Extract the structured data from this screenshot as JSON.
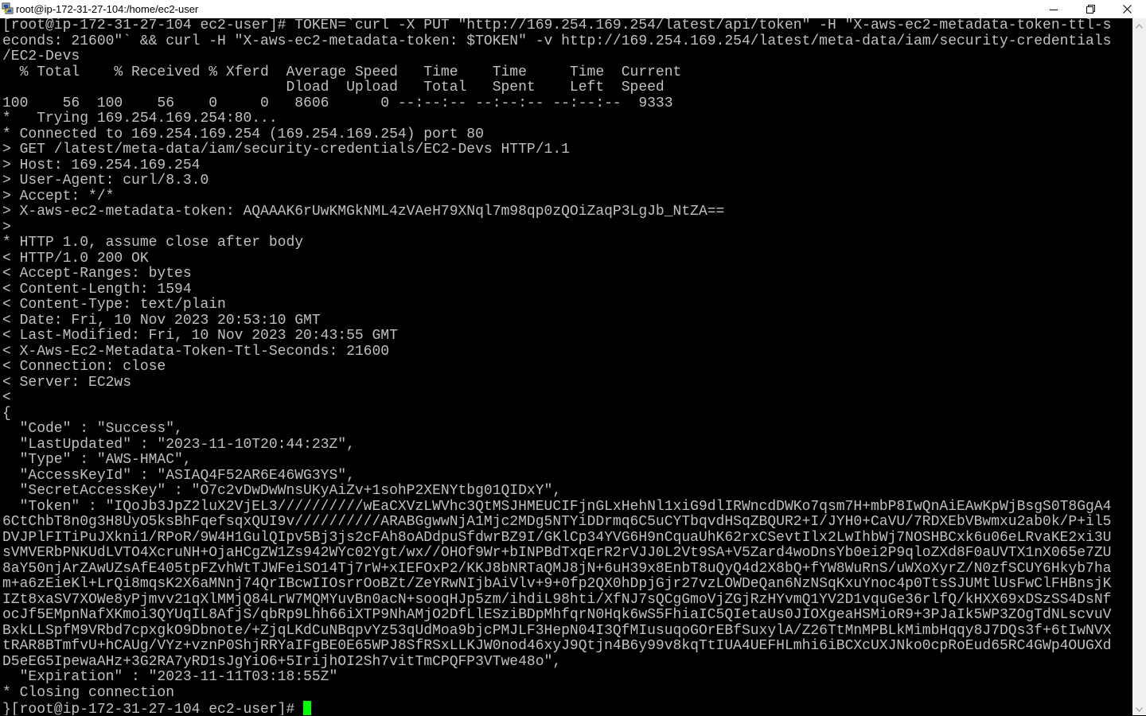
{
  "window": {
    "title": "root@ip-172-31-27-104:/home/ec2-user",
    "icons": {
      "app": "putty-icon",
      "minimize": "minimize-icon",
      "maximize": "restore-icon",
      "close": "close-icon"
    }
  },
  "terminal": {
    "colors": {
      "background": "#000000",
      "foreground": "#c0c0c0",
      "cursor": "#00ff00"
    },
    "lines": [
      "[root@ip-172-31-27-104 ec2-user]# TOKEN=`curl -X PUT \"http://169.254.169.254/latest/api/token\" -H \"X-aws-ec2-metadata-token-ttl-s",
      "econds: 21600\"` && curl -H \"X-aws-ec2-metadata-token: $TOKEN\" -v http://169.254.169.254/latest/meta-data/iam/security-credentials",
      "/EC2-Devs",
      "  % Total    % Received % Xferd  Average Speed   Time    Time     Time  Current",
      "                                 Dload  Upload   Total   Spent    Left  Speed",
      "100    56  100    56    0     0   8606      0 --:--:-- --:--:-- --:--:--  9333",
      "*   Trying 169.254.169.254:80...",
      "* Connected to 169.254.169.254 (169.254.169.254) port 80",
      "> GET /latest/meta-data/iam/security-credentials/EC2-Devs HTTP/1.1",
      "> Host: 169.254.169.254",
      "> User-Agent: curl/8.3.0",
      "> Accept: */*",
      "> X-aws-ec2-metadata-token: AQAAAK6rUwKMGkNML4zVAeH79XNql7m98qp0zQOiZaqP3LgJb_NtZA==",
      ">",
      "* HTTP 1.0, assume close after body",
      "< HTTP/1.0 200 OK",
      "< Accept-Ranges: bytes",
      "< Content-Length: 1594",
      "< Content-Type: text/plain",
      "< Date: Fri, 10 Nov 2023 20:53:10 GMT",
      "< Last-Modified: Fri, 10 Nov 2023 20:43:55 GMT",
      "< X-Aws-Ec2-Metadata-Token-Ttl-Seconds: 21600",
      "< Connection: close",
      "< Server: EC2ws",
      "<",
      "{",
      "  \"Code\" : \"Success\",",
      "  \"LastUpdated\" : \"2023-11-10T20:44:23Z\",",
      "  \"Type\" : \"AWS-HMAC\",",
      "  \"AccessKeyId\" : \"ASIAQ4F52AR6E46WG3YS\",",
      "  \"SecretAccessKey\" : \"O7c2vDwDwWnsUKyAiZv+1sohP2XENYtbg01QIDxY\",",
      "  \"Token\" : \"IQoJb3JpZ2luX2VjEL3//////////wEaCXVzLWVhc3QtMSJHMEUCIFjnGLxHehNl1xiG9dlIRWncdDWKo7qsm7H+mbP8IwQnAiEAwKpWjBsgS0T8GgA4",
      "6CtChbT8n0g3H8UyO5ksBhFqefsqxQUI9v//////////ARABGgwwNjA1Mjc2MDg5NTYiDDrmq6C5uCYTbqvdHSqZBQUR2+I/JYH0+CaVU/7RDXEbVBwmxu2ab0k/P+il5",
      "DVJPlFITiPuJXkni1/RPoR/9W4H1GulQIpv5Bj3js2cFAh8oADdpuSfdwrBZ9I/GKlCp34YVG6H9nCquaUhK62rxCSevtIlx2LwIhbWj7NOSHBCxk6u06eLRvaKE2xi3U",
      "sVMVERbPNKUdLVTO4XcruNH+OjaHCgZW1Zs942WYc02Ygt/wx//OHOf9Wr+bINPBdTxqErR2rVJJ0L2Vt9SA+V5Zard4woDnsYb0ei2P9qloZXd8F0aUVTX1nX065e7ZU",
      "8aY50njArZAwUZsAfE405tpFZvhWtTJWFeiSO14Tj7rW+xIEFOxP2/KKJ8bNRTaQMJ8jN+6uH39x8EnbT8uQyQ4d2X8bQ+fYW8WuRnS/uWXoXyrZ/N0zfSCUY6Hkyb7ha",
      "m+a6zEieKl+LrQi8mqsK2X6aMNnj74QrIBcwIIOsrrOoBZt/ZeYRwNIjbAiVlv+9+0fp2QX0hDpjGjr27vzLOWDeQan6NzNSqKxuYnoc4p0TtsSJUMtlUsFwClFHBnsjK",
      "IZt8xaSV7XOWe8yPjmvv21qXlMMjQ84LrW7MQMYuvBn0acN+sooqHJp5zm/ihdiL98hti/XfNJ7sQCgGmoVjZGjRzHYvmQ1YV2D1vquGe36rlfQ/kHXX69xDSzSS4DsNf",
      "ocJf5EMpnNafXKmoi3QYUqIL8AfjS/qbRp9Lhh66iXTP9NhAMjO2DfLlESziBDpMhfqrN0Hqk6wS5FhiaIC5QIetaUs0JIOXgeaHSMioR9+3PJaIk5WP3ZOgTdNLscvuV",
      "BxkLLSpfM9VRbd7cpxgkO9Dbnote/+ZjqLKdCuNBqpvYz53qUdMoa9bjcPMJLF3HepN04I3QfMIusuqoGOrEBfSuxylA/Z26TtMnMPBLkMimbHqqy8J7DQs3f+6tIwNVX",
      "tRAR8BTmfvU+hCAUg/VYz+vznP0ShjRRYaIFgBE0E65WPJ8SfRSxLLKJW0nod46xyJ9Qtjn4B6y99v8kqTtIUA4UEFHLmhi6iBCXcUXJNko0cpRoEud65RC4GWp4OUGXd",
      "D5eEG5IpewaAHz+3G2RA7yRD1sJgYiO6+5IrijhOI2Sh7vitTmCPQFP3VTwe48o\",",
      "  \"Expiration\" : \"2023-11-11T03:18:55Z\"",
      "* Closing connection",
      "}[root@ip-172-31-27-104 ec2-user]# "
    ]
  },
  "scrollbar": {
    "up_icon": "scroll-up-arrow-icon",
    "down_icon": "scroll-down-arrow-icon"
  }
}
